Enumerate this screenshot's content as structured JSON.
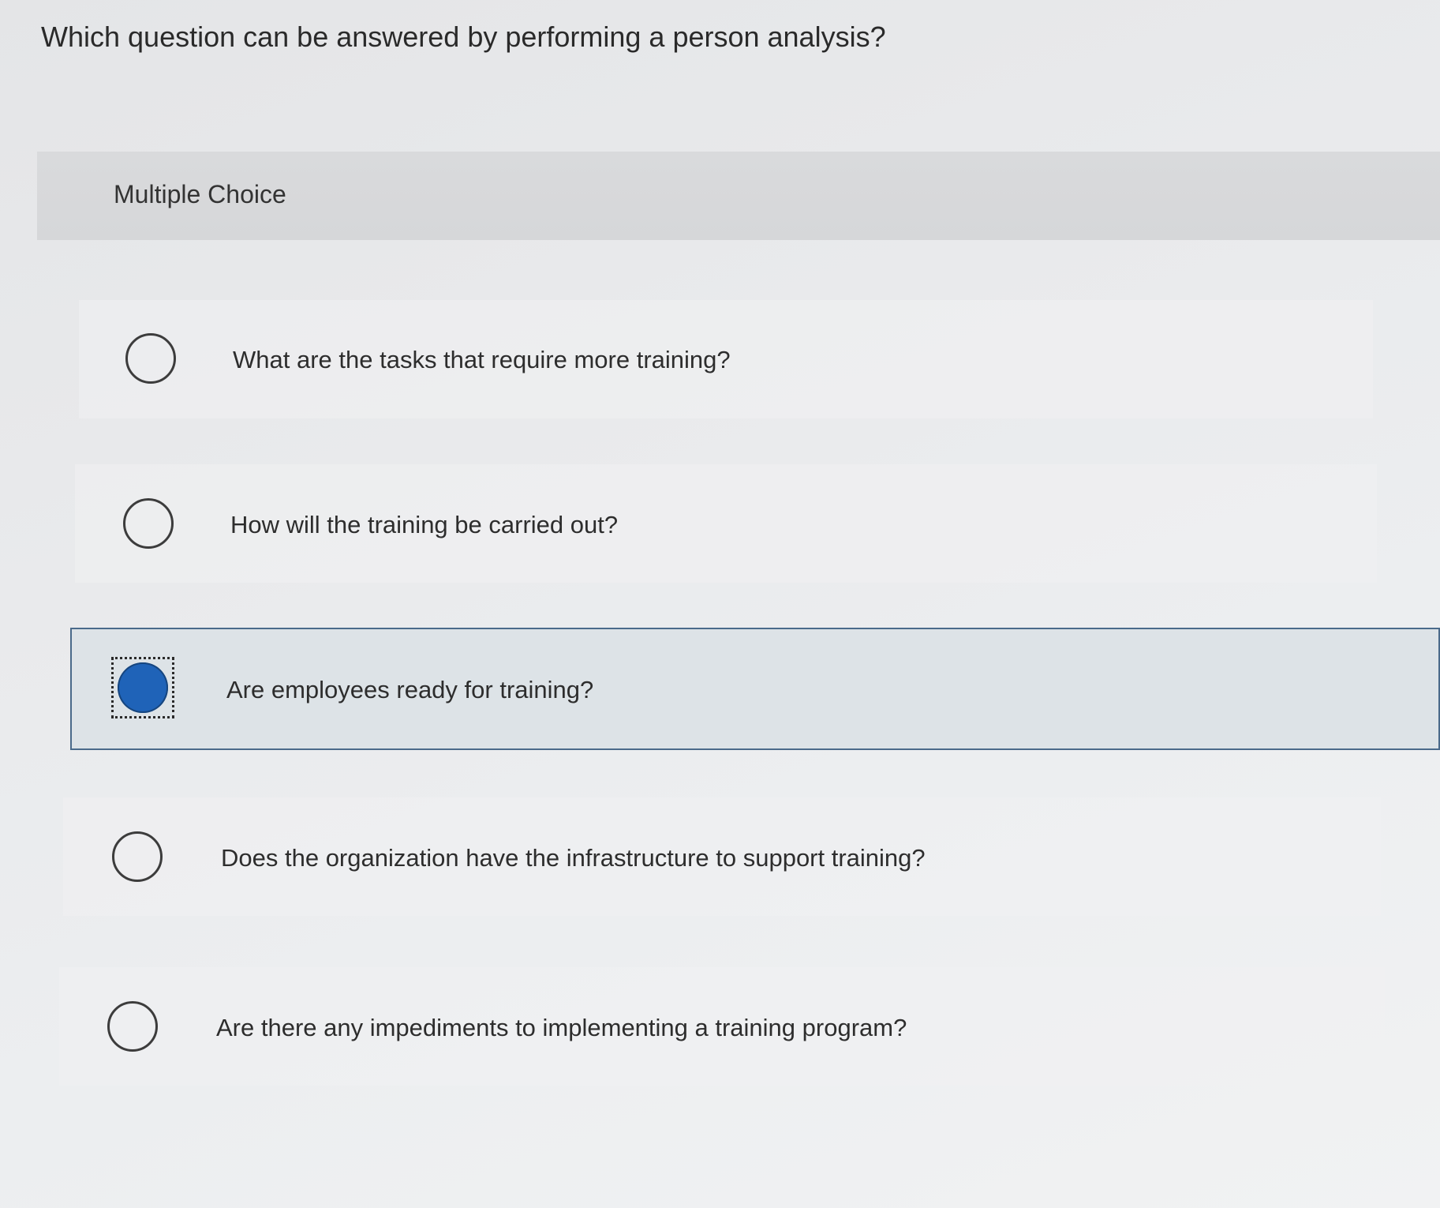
{
  "question": {
    "text": "Which question can be answered by performing a person analysis?"
  },
  "header": {
    "label": "Multiple Choice"
  },
  "options": [
    {
      "label": "What are the tasks that require more training?",
      "selected": false
    },
    {
      "label": "How will the training be carried out?",
      "selected": false
    },
    {
      "label": "Are employees ready for training?",
      "selected": true
    },
    {
      "label": "Does the organization have the infrastructure to support training?",
      "selected": false
    },
    {
      "label": "Are there any impediments to implementing a training program?",
      "selected": false
    }
  ],
  "colors": {
    "selected_radio": "#1f63b8",
    "selected_border": "#4a6a8a"
  }
}
